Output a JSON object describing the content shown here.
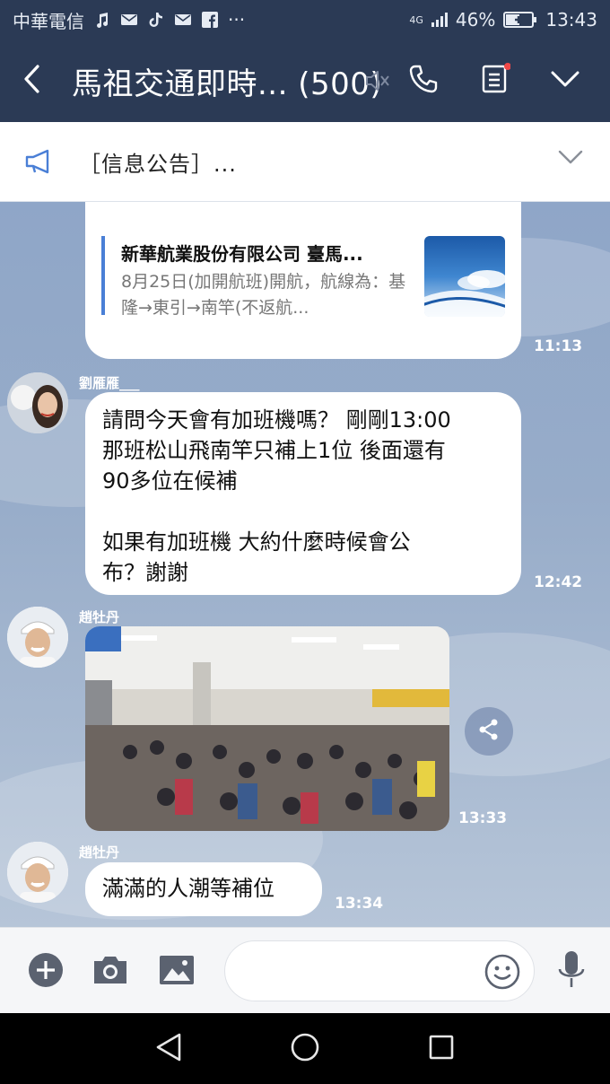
{
  "status_bar": {
    "carrier": "中華電信",
    "network": "4G",
    "battery": "46%",
    "time": "13:43",
    "more": "···"
  },
  "header": {
    "title": "馬祖交通即時... (500)",
    "back_icon": "chevron-left-icon",
    "mute_icon": "speaker-muted-icon",
    "call_icon": "phone-icon",
    "menu_icon": "note-list-icon",
    "expand_icon": "chevron-down-icon",
    "notification_dot_color": "#f04848"
  },
  "notice": {
    "text": "［信息公告］..."
  },
  "messages": [
    {
      "type": "link",
      "title": "新華航業股份有限公司 臺馬...",
      "desc": "8月25日(加開航班)開航，航線為：基隆→東引→南竿(不返航...",
      "time": "11:13"
    },
    {
      "type": "text",
      "sender": "劉雁雁___",
      "text": "請問今天會有加班機嗎？ 剛剛13:00\n那班松山飛南竿只補上1位 後面還有\n90多位在候補\n\n如果有加班機 大約什麼時候會公\n布？謝謝",
      "time": "12:42"
    },
    {
      "type": "image",
      "sender": "趙牡丹",
      "time": "13:33"
    },
    {
      "type": "text",
      "sender": "趙牡丹",
      "text": "滿滿的人潮等補位",
      "time": "13:34"
    }
  ],
  "input_bar": {
    "placeholder": ""
  },
  "colors": {
    "header_bg": "#2b3a55",
    "chat_bg": "#8fa6c8",
    "link_accent": "#4a7fd6"
  }
}
